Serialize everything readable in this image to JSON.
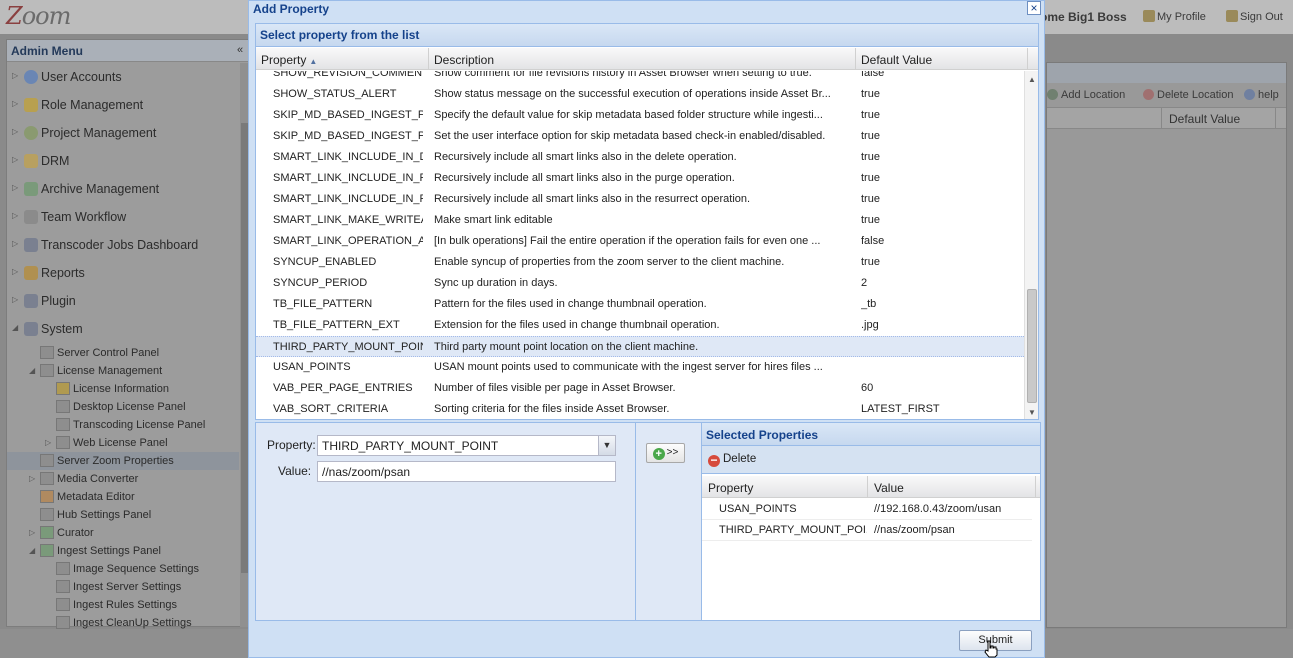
{
  "app": {
    "logo": "Zoom",
    "welcome": "ome Big1 Boss",
    "my_profile": "My Profile",
    "sign_out": "Sign Out"
  },
  "sidebar": {
    "title": "Admin Menu",
    "collapse_glyph": "«",
    "items": [
      {
        "label": "User Accounts"
      },
      {
        "label": "Role Management"
      },
      {
        "label": "Project Management"
      },
      {
        "label": "DRM"
      },
      {
        "label": "Archive Management"
      },
      {
        "label": "Team Workflow"
      },
      {
        "label": "Transcoder Jobs Dashboard"
      },
      {
        "label": "Reports"
      },
      {
        "label": "Plugin"
      },
      {
        "label": "System"
      }
    ],
    "sub_items": [
      {
        "label": "Server Control Panel"
      },
      {
        "label": "License Management"
      },
      {
        "label": "License Information"
      },
      {
        "label": "Desktop License Panel"
      },
      {
        "label": "Transcoding License Panel"
      },
      {
        "label": "Web License Panel"
      },
      {
        "label": "Server Zoom Properties"
      },
      {
        "label": "Media Converter"
      },
      {
        "label": "Metadata Editor"
      },
      {
        "label": "Hub Settings Panel"
      },
      {
        "label": "Curator"
      },
      {
        "label": "Ingest Settings Panel"
      },
      {
        "label": "Image Sequence Settings"
      },
      {
        "label": "Ingest Server Settings"
      },
      {
        "label": "Ingest Rules Settings"
      },
      {
        "label": "Ingest CleanUp Settings"
      }
    ]
  },
  "right_panel": {
    "add_location": "Add Location",
    "delete_location": "Delete Location",
    "help": "help",
    "column_default_value": "Default Value"
  },
  "dialog": {
    "title": "Add Property",
    "close_glyph": "×",
    "grid": {
      "title": "Select property from the list",
      "columns": {
        "property": "Property",
        "description": "Description",
        "default_value": "Default Value"
      },
      "rows": [
        {
          "property": "SHOW_REVISION_COMMENT",
          "description": "Show comment for file revisions history in Asset Browser when setting to true.",
          "default": "false"
        },
        {
          "property": "SHOW_STATUS_ALERT",
          "description": "Show status message on the successful execution of operations inside Asset Br...",
          "default": "true"
        },
        {
          "property": "SKIP_MD_BASED_INGEST_PA...",
          "description": "Specify the default value for skip metadata based folder structure while ingesti...",
          "default": "true"
        },
        {
          "property": "SKIP_MD_BASED_INGEST_PA...",
          "description": "Set the user interface option for skip metadata based check-in enabled/disabled.",
          "default": "true"
        },
        {
          "property": "SMART_LINK_INCLUDE_IN_D...",
          "description": "Recursively include all smart links also in the delete operation.",
          "default": "true"
        },
        {
          "property": "SMART_LINK_INCLUDE_IN_P...",
          "description": "Recursively include all smart links also in the purge operation.",
          "default": "true"
        },
        {
          "property": "SMART_LINK_INCLUDE_IN_R...",
          "description": "Recursively include all smart links also in the resurrect operation.",
          "default": "true"
        },
        {
          "property": "SMART_LINK_MAKE_WRITEA...",
          "description": "Make smart link editable",
          "default": "true"
        },
        {
          "property": "SMART_LINK_OPERATION_A...",
          "description": "[In bulk operations] Fail the entire operation if the operation fails for even one ...",
          "default": "false"
        },
        {
          "property": "SYNCUP_ENABLED",
          "description": "Enable syncup of properties from the zoom server to the client machine.",
          "default": "true"
        },
        {
          "property": "SYNCUP_PERIOD",
          "description": "Sync up duration in days.",
          "default": "2"
        },
        {
          "property": "TB_FILE_PATTERN",
          "description": "Pattern for the files used in change thumbnail operation.",
          "default": "_tb"
        },
        {
          "property": "TB_FILE_PATTERN_EXT",
          "description": "Extension for the files used in change thumbnail operation.",
          "default": ".jpg"
        },
        {
          "property": "THIRD_PARTY_MOUNT_POINT",
          "description": "Third party mount point location on the client machine.",
          "default": ""
        },
        {
          "property": "USAN_POINTS",
          "description": "USAN mount points used to communicate with the ingest server for hires files ...",
          "default": ""
        },
        {
          "property": "VAB_PER_PAGE_ENTRIES",
          "description": "Number of files visible per page in Asset Browser.",
          "default": "60"
        },
        {
          "property": "VAB_SORT_CRITERIA",
          "description": "Sorting criteria for the files inside Asset Browser.",
          "default": "LATEST_FIRST"
        }
      ],
      "selected_row_index": 13
    },
    "form": {
      "property_label": "Property:",
      "property_value": "THIRD_PARTY_MOUNT_POINT",
      "value_label": "Value:",
      "value_value": "//nas/zoom/psan"
    },
    "add_button": {
      "label": ">>"
    },
    "selected": {
      "title": "Selected Properties",
      "delete_label": "Delete",
      "columns": {
        "property": "Property",
        "value": "Value"
      },
      "rows": [
        {
          "property": "USAN_POINTS",
          "value": "//192.168.0.43/zoom/usan"
        },
        {
          "property": "THIRD_PARTY_MOUNT_POI...",
          "value": "//nas/zoom/psan"
        }
      ]
    },
    "submit_label": "Submit"
  },
  "colors": {
    "dialog_bg": "#cfe0f4",
    "header_text": "#15428b",
    "selected_row": "#dfe8f6"
  }
}
